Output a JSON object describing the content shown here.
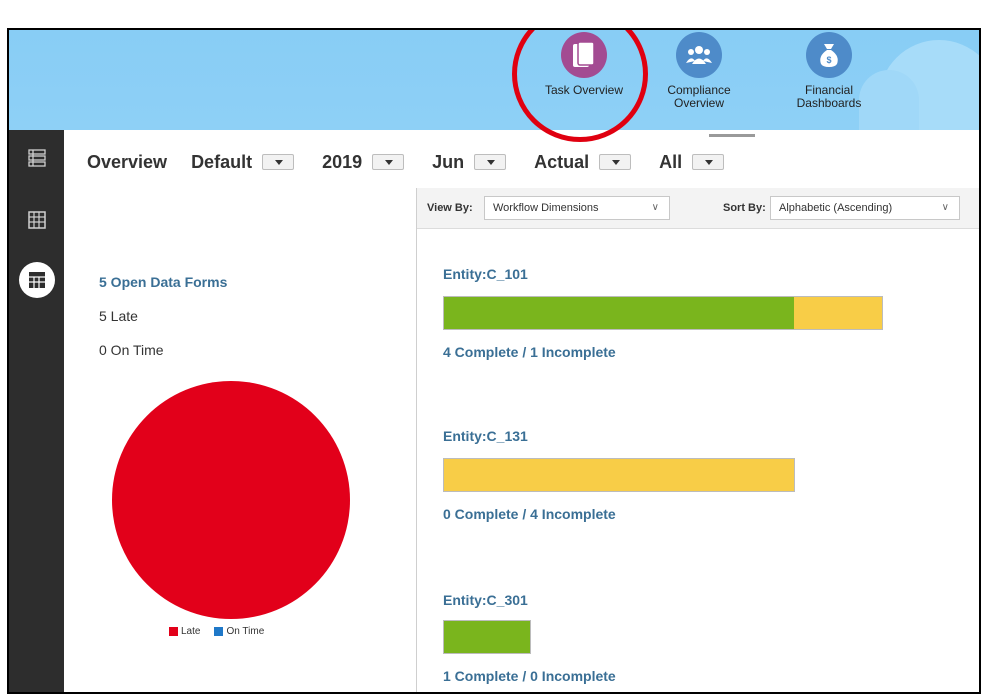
{
  "nav": {
    "items": [
      {
        "label_lines": [
          "Task Overview"
        ],
        "icon": "task-overview-icon",
        "color": "#a34b92"
      },
      {
        "label_lines": [
          "Compliance",
          "Overview"
        ],
        "icon": "compliance-people-icon",
        "color": "#4e8bc9"
      },
      {
        "label_lines": [
          "Financial",
          "Dashboards"
        ],
        "icon": "money-bag-icon",
        "color": "#4e8bc9"
      }
    ]
  },
  "filters": {
    "title": "Overview",
    "pov": [
      "Default",
      "2019",
      "Jun",
      "Actual",
      "All"
    ]
  },
  "summary": {
    "open_forms": "5  Open Data Forms",
    "late": "5  Late",
    "on_time": "0  On Time",
    "legend": [
      {
        "label": "Late",
        "color": "#e2001a"
      },
      {
        "label": "On Time",
        "color": "#1f78c8"
      }
    ],
    "late_count": 5,
    "on_time_count": 0
  },
  "viewbar": {
    "view_by_label": "View By:",
    "view_by_value": "Workflow Dimensions",
    "sort_by_label": "Sort By:",
    "sort_by_value": "Alphabetic (Ascending)"
  },
  "entities": [
    {
      "title": "Entity:C_101",
      "complete": 4,
      "incomplete": 1,
      "status": "4 Complete / 1 Incomplete"
    },
    {
      "title": "Entity:C_131",
      "complete": 0,
      "incomplete": 4,
      "status": "0 Complete / 4 Incomplete"
    },
    {
      "title": "Entity:C_301",
      "complete": 1,
      "incomplete": 0,
      "status": "1 Complete / 0 Incomplete"
    }
  ],
  "colors": {
    "complete": "#7ab51d",
    "incomplete": "#f8cd47",
    "late": "#e2001a",
    "accent_text": "#3a6f95"
  }
}
